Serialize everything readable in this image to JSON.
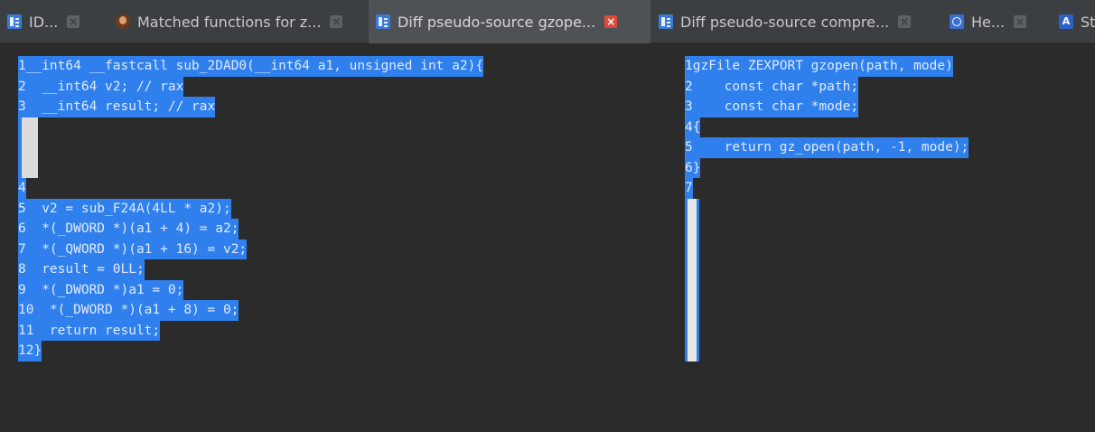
{
  "tabs": [
    {
      "label": "ID...",
      "icon": "doc-icon",
      "active": false
    },
    {
      "label": "Matched functions for z...",
      "icon": "person-icon",
      "active": false
    },
    {
      "label": "Diff pseudo-source gzope...",
      "icon": "doc-icon",
      "active": true
    },
    {
      "label": "Diff pseudo-source compre...",
      "icon": "doc-icon",
      "active": false
    },
    {
      "label": "He...",
      "icon": "hex-icon",
      "active": false
    },
    {
      "label": "St",
      "icon": "string-icon",
      "active": false
    }
  ],
  "tab_close_glyph": "×",
  "string_icon_letter": "A",
  "left_pane": {
    "lines": [
      {
        "num": "1",
        "code": "__int64 __fastcall sub_2DAD0(__int64 a1, unsigned int a2){"
      },
      {
        "num": "2",
        "code": "  __int64 v2; // rax"
      },
      {
        "num": "3",
        "code": "  __int64 result; // rax"
      },
      {
        "num": "",
        "code": ""
      },
      {
        "num": "",
        "code": ""
      },
      {
        "num": "",
        "code": ""
      },
      {
        "num": "4",
        "code": ""
      },
      {
        "num": "5",
        "code": "  v2 = sub_F24A(4LL * a2);"
      },
      {
        "num": "6",
        "code": "  *(_DWORD *)(a1 + 4) = a2;"
      },
      {
        "num": "7",
        "code": "  *(_QWORD *)(a1 + 16) = v2;"
      },
      {
        "num": "8",
        "code": "  result = 0LL;"
      },
      {
        "num": "9",
        "code": "  *(_DWORD *)a1 = 0;"
      },
      {
        "num": "10",
        "code": "  *(_DWORD *)(a1 + 8) = 0;"
      },
      {
        "num": "11",
        "code": "  return result;"
      },
      {
        "num": "12",
        "code": "}"
      }
    ]
  },
  "right_pane": {
    "lines": [
      {
        "num": "1",
        "code": "gzFile ZEXPORT gzopen(path, mode)"
      },
      {
        "num": "2",
        "code": "    const char *path;"
      },
      {
        "num": "3",
        "code": "    const char *mode;"
      },
      {
        "num": "4",
        "code": "{"
      },
      {
        "num": "5",
        "code": "    return gz_open(path, -1, mode);"
      },
      {
        "num": "6",
        "code": "}"
      },
      {
        "num": "7",
        "code": ""
      }
    ]
  },
  "colors": {
    "selection": "#2f80ed",
    "background": "#2b2b2b",
    "tabbar": "#3c3f41",
    "active_tab": "#4f5254",
    "active_close": "#e0483b"
  }
}
